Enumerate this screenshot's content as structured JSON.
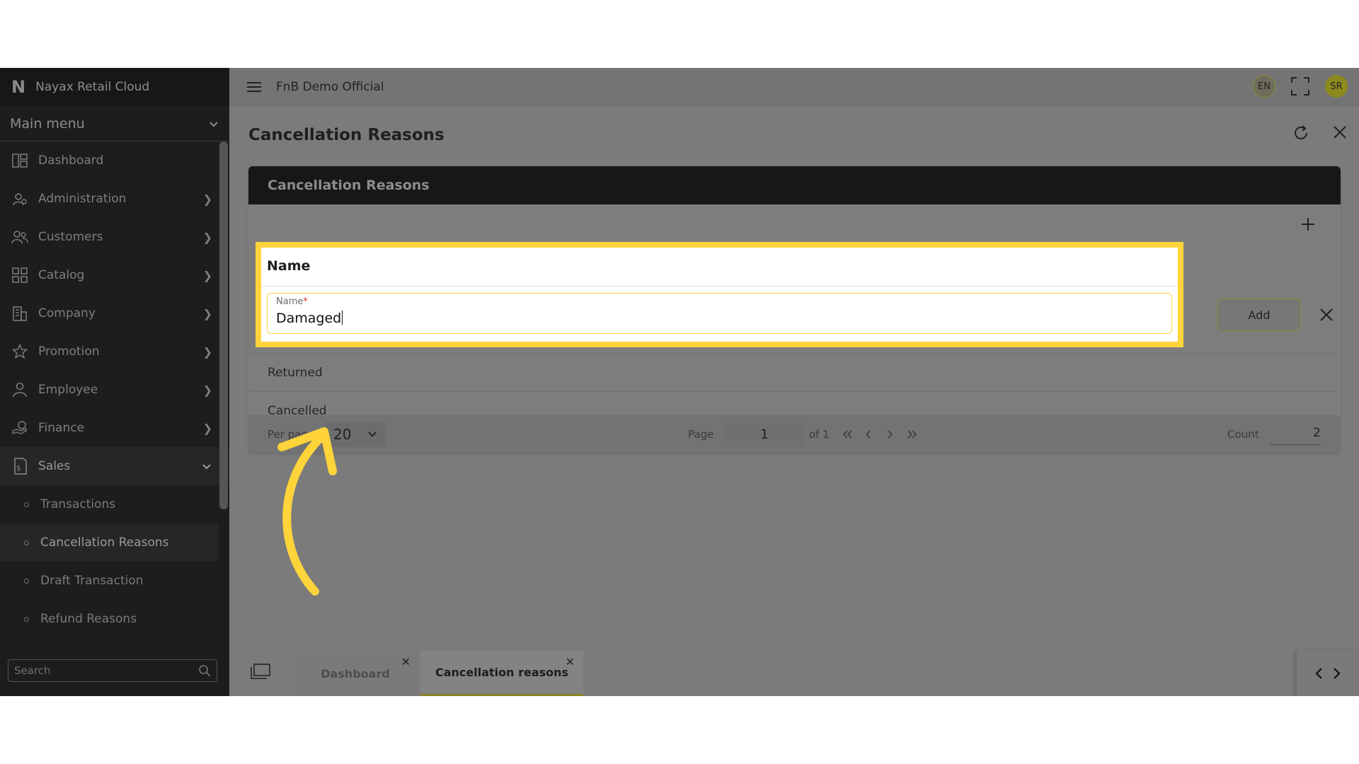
{
  "app": {
    "brand": "Nayax Retail Cloud",
    "logo_letter": "N",
    "tenant": "FnB Demo Official"
  },
  "sidebar": {
    "main_menu": "Main menu",
    "items": [
      {
        "label": "Dashboard",
        "icon": "dashboard-icon"
      },
      {
        "label": "Administration",
        "icon": "admin-gear-icon"
      },
      {
        "label": "Customers",
        "icon": "customers-icon"
      },
      {
        "label": "Catalog",
        "icon": "catalog-grid-icon"
      },
      {
        "label": "Company",
        "icon": "company-building-icon"
      },
      {
        "label": "Promotion",
        "icon": "star-icon"
      },
      {
        "label": "Employee",
        "icon": "employee-icon"
      },
      {
        "label": "Finance",
        "icon": "finance-icon"
      },
      {
        "label": "Sales",
        "icon": "sales-icon"
      }
    ],
    "sales_sub": [
      "Transactions",
      "Cancellation Reasons",
      "Draft Transaction",
      "Refund Reasons"
    ],
    "search_placeholder": "Search"
  },
  "header": {
    "lang": "EN",
    "avatar": "SR"
  },
  "page": {
    "title": "Cancellation Reasons"
  },
  "card": {
    "title": "Cancellation Reasons",
    "column_name": "Name",
    "field_label": "Name",
    "field_required": "*",
    "field_value": "Damaged",
    "add_button": "Add",
    "rows": [
      "Returned",
      "Cancelled"
    ]
  },
  "pagination": {
    "per_page_label": "Per page:",
    "per_page_value": "20",
    "page_label": "Page",
    "page_value": "1",
    "of_label": "of 1",
    "count_label": "Count",
    "count_value": "2"
  },
  "tabs": [
    {
      "label": "Dashboard"
    },
    {
      "label": "Cancellation reasons"
    }
  ],
  "colors": {
    "highlight": "#ffd43b",
    "required": "#e0392b",
    "overlay": "#7b7b7b"
  }
}
